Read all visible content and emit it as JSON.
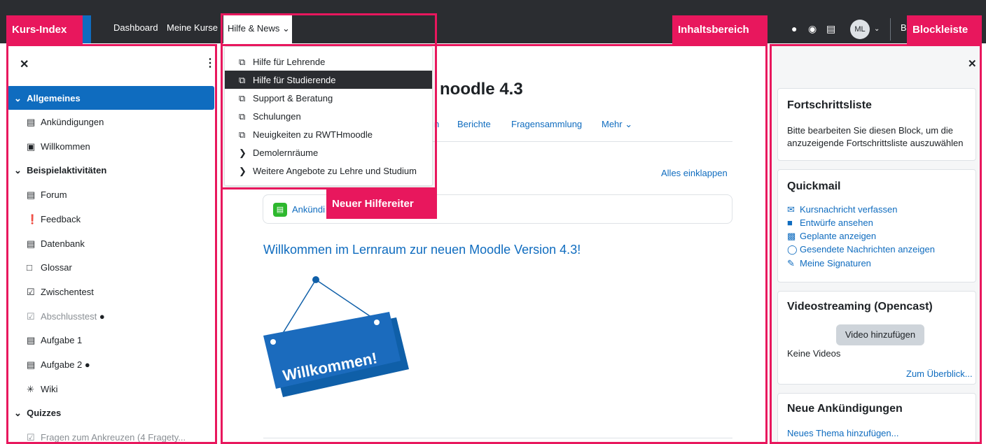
{
  "navbar": {
    "links": [
      "Dashboard",
      "Meine Kurse"
    ],
    "help_tab": "Hilfe & News ⌄",
    "avatar_initials": "ML",
    "truncated_label": "B"
  },
  "annotations": {
    "course_index": "Kurs-Index",
    "content_area": "Inhaltsbereich",
    "block_drawer": "Blockleiste",
    "new_help_tab": "Neuer Hilfereiter",
    "color": "#e8175d"
  },
  "course_index": {
    "sections": [
      {
        "label": "Allgemeines",
        "items": [
          {
            "icon": "announcement-icon",
            "label": "Ankündigungen"
          },
          {
            "icon": "page-icon",
            "label": "Willkommen"
          }
        ]
      },
      {
        "label": "Beispielaktivitäten",
        "items": [
          {
            "icon": "forum-icon",
            "label": "Forum"
          },
          {
            "icon": "feedback-icon",
            "label": "Feedback"
          },
          {
            "icon": "database-icon",
            "label": "Datenbank"
          },
          {
            "icon": "glossary-icon",
            "label": "Glossar"
          },
          {
            "icon": "quiz-icon",
            "label": "Zwischentest"
          },
          {
            "icon": "quiz-icon",
            "label": "Abschlusstest"
          },
          {
            "icon": "assignment-icon",
            "label": "Aufgabe 1"
          },
          {
            "icon": "assignment-icon",
            "label": "Aufgabe 2"
          },
          {
            "icon": "wiki-icon",
            "label": "Wiki"
          }
        ]
      },
      {
        "label": "Quizzes",
        "items": [
          {
            "icon": "quiz-icon",
            "label": "Fragen zum Ankreuzen (4 Fragety..."
          }
        ]
      }
    ]
  },
  "help_menu": {
    "items": [
      {
        "label": "Hilfe für Lehrende",
        "icon": "external-link-icon"
      },
      {
        "label": "Hilfe für Studierende",
        "icon": "external-link-icon"
      },
      {
        "label": "Support & Beratung",
        "icon": "external-link-icon"
      },
      {
        "label": "Schulungen",
        "icon": "external-link-icon"
      },
      {
        "label": "Neuigkeiten zu RWTHmoodle",
        "icon": "external-link-icon"
      },
      {
        "label": "Demolernräume",
        "icon": "chevron-right-icon"
      },
      {
        "label": "Weitere Angebote zu Lehre und Studium",
        "icon": "chevron-right-icon"
      }
    ]
  },
  "content": {
    "title_fragment": "noodle 4.3",
    "secondary_nav": [
      "n",
      "Berichte",
      "Fragensammlung",
      "Mehr ⌄"
    ],
    "collapse_all": "Alles einklappen",
    "activity_fragment": "Ankündi",
    "welcome_heading": "Willkommen im Lernraum zur neuen Moodle Version 4.3!",
    "sign_text": "Willkommen!"
  },
  "blocks": {
    "progress": {
      "title": "Fortschrittsliste",
      "text": "Bitte bearbeiten Sie diesen Block, um die anzuzeigende Fortschrittsliste auszuwählen"
    },
    "quickmail": {
      "title": "Quickmail",
      "links": [
        {
          "icon": "envelope-icon",
          "label": "Kursnachricht verfassen"
        },
        {
          "icon": "note-icon",
          "label": "Entwürfe ansehen"
        },
        {
          "icon": "calendar-icon",
          "label": "Geplante anzeigen"
        },
        {
          "icon": "chat-icon",
          "label": "Gesendete Nachrichten anzeigen"
        },
        {
          "icon": "pen-icon",
          "label": "Meine Signaturen"
        }
      ]
    },
    "video": {
      "title": "Videostreaming (Opencast)",
      "button": "Video hinzufügen",
      "empty": "Keine Videos",
      "overview": "Zum Überblick..."
    },
    "news": {
      "title": "Neue Ankündigungen",
      "link": "Neues Thema hinzufügen..."
    }
  }
}
